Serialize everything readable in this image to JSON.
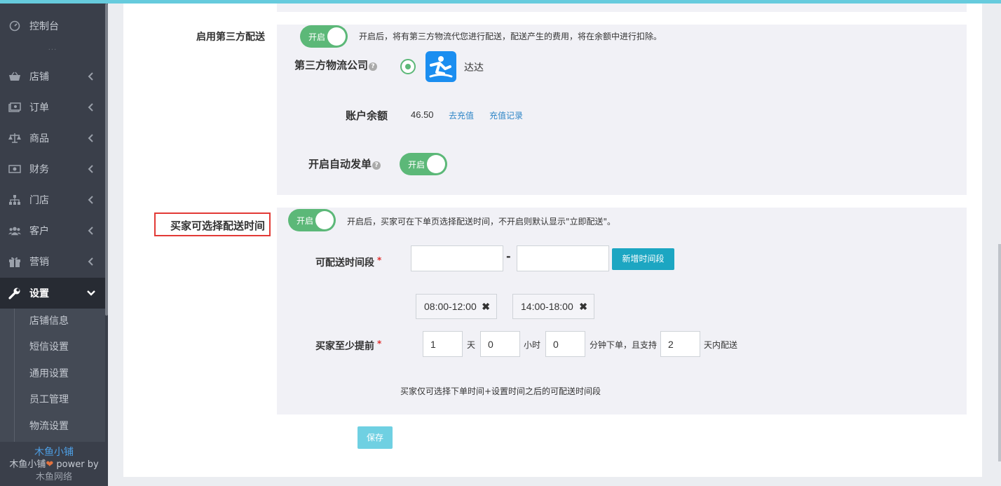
{
  "sidebar": {
    "items": [
      {
        "label": "控制台",
        "icon": "dashboard-icon"
      },
      {
        "label": "店铺",
        "icon": "basket-icon"
      },
      {
        "label": "订单",
        "icon": "money-icon"
      },
      {
        "label": "商品",
        "icon": "balance-scale-icon"
      },
      {
        "label": "财务",
        "icon": "cash-icon"
      },
      {
        "label": "门店",
        "icon": "sitemap-icon"
      },
      {
        "label": "客户",
        "icon": "users-icon"
      },
      {
        "label": "营销",
        "icon": "gift-icon"
      },
      {
        "label": "设置",
        "icon": "wrench-icon"
      }
    ],
    "dots": "···",
    "submenu": [
      "店铺信息",
      "短信设置",
      "通用设置",
      "员工管理",
      "物流设置"
    ],
    "brand": {
      "name": "木鱼小铺",
      "power_prefix": "木鱼小铺",
      "power_suffix": " power by",
      "company": "木鱼网络"
    }
  },
  "third_party": {
    "label": "启用第三方配送",
    "toggle": "开启",
    "desc": "开启后，将有第三方物流代您进行配送，配送产生的费用，将在余额中进行扣除。",
    "company_label": "第三方物流公司",
    "company_name": "达达",
    "balance_label": "账户余额",
    "balance_value": "46.50",
    "recharge_link": "去充值",
    "history_link": "充值记录",
    "auto_label": "开启自动发单",
    "auto_toggle": "开启"
  },
  "delivery_time": {
    "label": "买家可选择配送时间",
    "toggle": "开启",
    "desc": "开启后，买家可在下单页选择配送时间，不开启则默认显示\"立即配送\"。",
    "period_label": "可配送时间段",
    "required_mark": "*",
    "dash": "-",
    "start_value": "",
    "end_value": "",
    "add_button": "新增时间段",
    "tags": [
      "08:00-12:00",
      "14:00-18:00"
    ],
    "advance_label": "买家至少提前",
    "days_value": "1",
    "days_unit": "天",
    "hours_value": "0",
    "hours_unit": "小时",
    "minutes_value": "0",
    "minutes_unit": "分钟下单，且支持",
    "range_value": "2",
    "range_unit": "天内配送",
    "hint": "买家仅可选择下单时间+设置时间之后的可配送时间段"
  },
  "save_button": "保存",
  "colors": {
    "accent": "#1ca6c2",
    "toggle": "#5cb878",
    "highlight": "#e23a36",
    "link": "#2f86c7"
  }
}
